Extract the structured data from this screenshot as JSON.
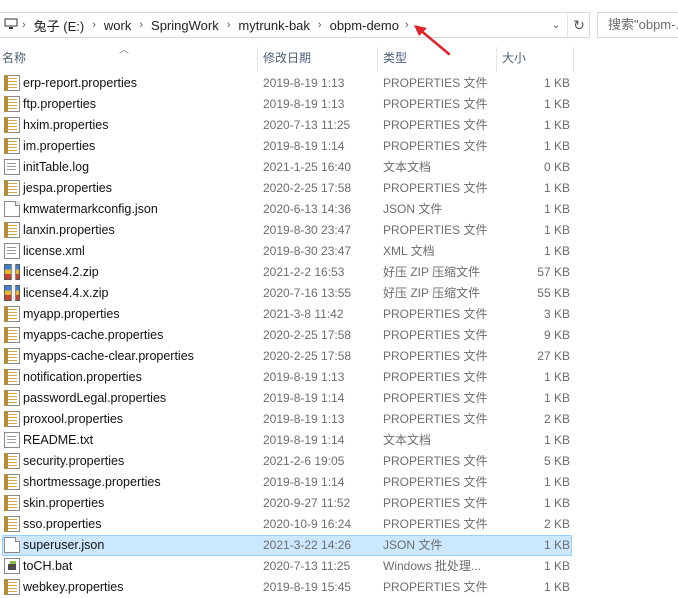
{
  "addressbar": {
    "segments": [
      "兔子 (E:)",
      "work",
      "SpringWork",
      "mytrunk-bak",
      "obpm-demo"
    ],
    "dropdown_icon": "chevron-down-icon",
    "refresh_icon": "refresh-icon"
  },
  "search": {
    "placeholder": "搜索\"obpm-..."
  },
  "columns": {
    "name": "名称",
    "modified": "修改日期",
    "type": "类型",
    "size": "大小"
  },
  "files": [
    {
      "name": "erp-report.properties",
      "date": "2019-8-19 1:13",
      "type": "PROPERTIES 文件",
      "size": "1 KB",
      "icon": "properties-file-icon"
    },
    {
      "name": "ftp.properties",
      "date": "2019-8-19 1:13",
      "type": "PROPERTIES 文件",
      "size": "1 KB",
      "icon": "properties-file-icon"
    },
    {
      "name": "hxim.properties",
      "date": "2020-7-13 11:25",
      "type": "PROPERTIES 文件",
      "size": "1 KB",
      "icon": "properties-file-icon"
    },
    {
      "name": "im.properties",
      "date": "2019-8-19 1:14",
      "type": "PROPERTIES 文件",
      "size": "1 KB",
      "icon": "properties-file-icon"
    },
    {
      "name": "initTable.log",
      "date": "2021-1-25 16:40",
      "type": "文本文档",
      "size": "0 KB",
      "icon": "text-document-icon"
    },
    {
      "name": "jespa.properties",
      "date": "2020-2-25 17:58",
      "type": "PROPERTIES 文件",
      "size": "1 KB",
      "icon": "properties-file-icon"
    },
    {
      "name": "kmwatermarkconfig.json",
      "date": "2020-6-13 14:36",
      "type": "JSON 文件",
      "size": "1 KB",
      "icon": "blank-file-icon"
    },
    {
      "name": "lanxin.properties",
      "date": "2019-8-30 23:47",
      "type": "PROPERTIES 文件",
      "size": "1 KB",
      "icon": "properties-file-icon"
    },
    {
      "name": "license.xml",
      "date": "2019-8-30 23:47",
      "type": "XML 文档",
      "size": "1 KB",
      "icon": "text-document-icon"
    },
    {
      "name": "license4.2.zip",
      "date": "2021-2-2 16:53",
      "type": "好压 ZIP 压缩文件",
      "size": "57 KB",
      "icon": "zip-archive-icon"
    },
    {
      "name": "license4.4.x.zip",
      "date": "2020-7-16 13:55",
      "type": "好压 ZIP 压缩文件",
      "size": "55 KB",
      "icon": "zip-archive-icon"
    },
    {
      "name": "myapp.properties",
      "date": "2021-3-8 11:42",
      "type": "PROPERTIES 文件",
      "size": "3 KB",
      "icon": "properties-file-icon"
    },
    {
      "name": "myapps-cache.properties",
      "date": "2020-2-25 17:58",
      "type": "PROPERTIES 文件",
      "size": "9 KB",
      "icon": "properties-file-icon"
    },
    {
      "name": "myapps-cache-clear.properties",
      "date": "2020-2-25 17:58",
      "type": "PROPERTIES 文件",
      "size": "27 KB",
      "icon": "properties-file-icon"
    },
    {
      "name": "notification.properties",
      "date": "2019-8-19 1:13",
      "type": "PROPERTIES 文件",
      "size": "1 KB",
      "icon": "properties-file-icon"
    },
    {
      "name": "passwordLegal.properties",
      "date": "2019-8-19 1:14",
      "type": "PROPERTIES 文件",
      "size": "1 KB",
      "icon": "properties-file-icon"
    },
    {
      "name": "proxool.properties",
      "date": "2019-8-19 1:13",
      "type": "PROPERTIES 文件",
      "size": "2 KB",
      "icon": "properties-file-icon"
    },
    {
      "name": "README.txt",
      "date": "2019-8-19 1:14",
      "type": "文本文档",
      "size": "1 KB",
      "icon": "text-document-icon"
    },
    {
      "name": "security.properties",
      "date": "2021-2-6 19:05",
      "type": "PROPERTIES 文件",
      "size": "5 KB",
      "icon": "properties-file-icon"
    },
    {
      "name": "shortmessage.properties",
      "date": "2019-8-19 1:14",
      "type": "PROPERTIES 文件",
      "size": "1 KB",
      "icon": "properties-file-icon"
    },
    {
      "name": "skin.properties",
      "date": "2020-9-27 11:52",
      "type": "PROPERTIES 文件",
      "size": "1 KB",
      "icon": "properties-file-icon"
    },
    {
      "name": "sso.properties",
      "date": "2020-10-9 16:24",
      "type": "PROPERTIES 文件",
      "size": "2 KB",
      "icon": "properties-file-icon"
    },
    {
      "name": "superuser.json",
      "date": "2021-3-22 14:26",
      "type": "JSON 文件",
      "size": "1 KB",
      "icon": "blank-file-icon",
      "selected": true
    },
    {
      "name": "toCH.bat",
      "date": "2020-7-13 11:25",
      "type": "Windows 批处理...",
      "size": "1 KB",
      "icon": "batch-file-icon"
    },
    {
      "name": "webkey.properties",
      "date": "2019-8-19 15:45",
      "type": "PROPERTIES 文件",
      "size": "1 KB",
      "icon": "properties-file-icon"
    }
  ],
  "colors": {
    "selection_bg": "#cce8ff",
    "selection_border": "#99d1ff",
    "header_text": "#4c607a",
    "annotation_arrow": "#e0242b"
  }
}
